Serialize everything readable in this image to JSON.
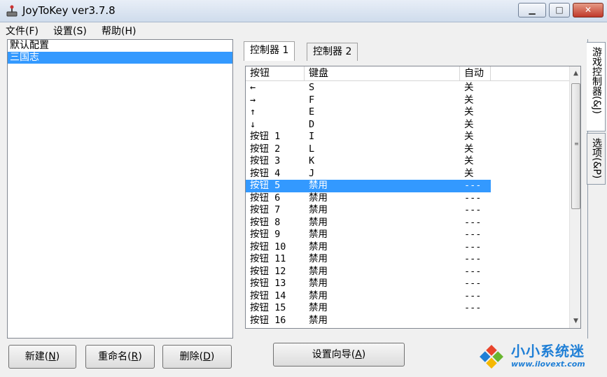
{
  "window": {
    "title": "JoyToKey ver3.7.8",
    "minimize": "▁",
    "maximize": "□",
    "close": "✕"
  },
  "menu": [
    "文件(F)",
    "设置(S)",
    "帮助(H)"
  ],
  "profiles": [
    {
      "name": "默认配置",
      "selected": false
    },
    {
      "name": "三国志",
      "selected": true
    }
  ],
  "buttons": {
    "new": {
      "text": "新建(",
      "key": "N",
      "tail": ")"
    },
    "rename": {
      "text": "重命名(",
      "key": "R",
      "tail": ")"
    },
    "delete": {
      "text": "删除(",
      "key": "D",
      "tail": ")"
    },
    "wizard": {
      "text": "设置向导(",
      "key": "A",
      "tail": ")"
    }
  },
  "controller_tabs": [
    "控制器 1",
    "控制器 2"
  ],
  "columns": [
    "按钮",
    "键盘",
    "自动"
  ],
  "rows": [
    {
      "button": "←",
      "key": "S",
      "auto": "关"
    },
    {
      "button": "→",
      "key": "F",
      "auto": "关"
    },
    {
      "button": "↑",
      "key": "E",
      "auto": "关"
    },
    {
      "button": "↓",
      "key": "D",
      "auto": "关"
    },
    {
      "button": "按钮 1",
      "key": "I",
      "auto": "关"
    },
    {
      "button": "按钮 2",
      "key": "L",
      "auto": "关"
    },
    {
      "button": "按钮 3",
      "key": "K",
      "auto": "关"
    },
    {
      "button": "按钮 4",
      "key": "J",
      "auto": "关"
    },
    {
      "button": "按钮 5",
      "key": "禁用",
      "auto": "---",
      "selected": true
    },
    {
      "button": "按钮 6",
      "key": "禁用",
      "auto": "---"
    },
    {
      "button": "按钮 7",
      "key": "禁用",
      "auto": "---"
    },
    {
      "button": "按钮 8",
      "key": "禁用",
      "auto": "---"
    },
    {
      "button": "按钮 9",
      "key": "禁用",
      "auto": "---"
    },
    {
      "button": "按钮 10",
      "key": "禁用",
      "auto": "---"
    },
    {
      "button": "按钮 11",
      "key": "禁用",
      "auto": "---"
    },
    {
      "button": "按钮 12",
      "key": "禁用",
      "auto": "---"
    },
    {
      "button": "按钮 13",
      "key": "禁用",
      "auto": "---"
    },
    {
      "button": "按钮 14",
      "key": "禁用",
      "auto": "---"
    },
    {
      "button": "按钮 15",
      "key": "禁用",
      "auto": "---"
    },
    {
      "button": "按钮 16",
      "key": "禁用",
      "auto": ""
    }
  ],
  "side_tabs": [
    "游戏控制器(&J)",
    "选项(&P)"
  ],
  "watermark": {
    "title": "小小系统迷",
    "url": "www.ilovext.com"
  },
  "colors": {
    "selection": "#3399ff",
    "watermark": "#1f7fd6"
  }
}
